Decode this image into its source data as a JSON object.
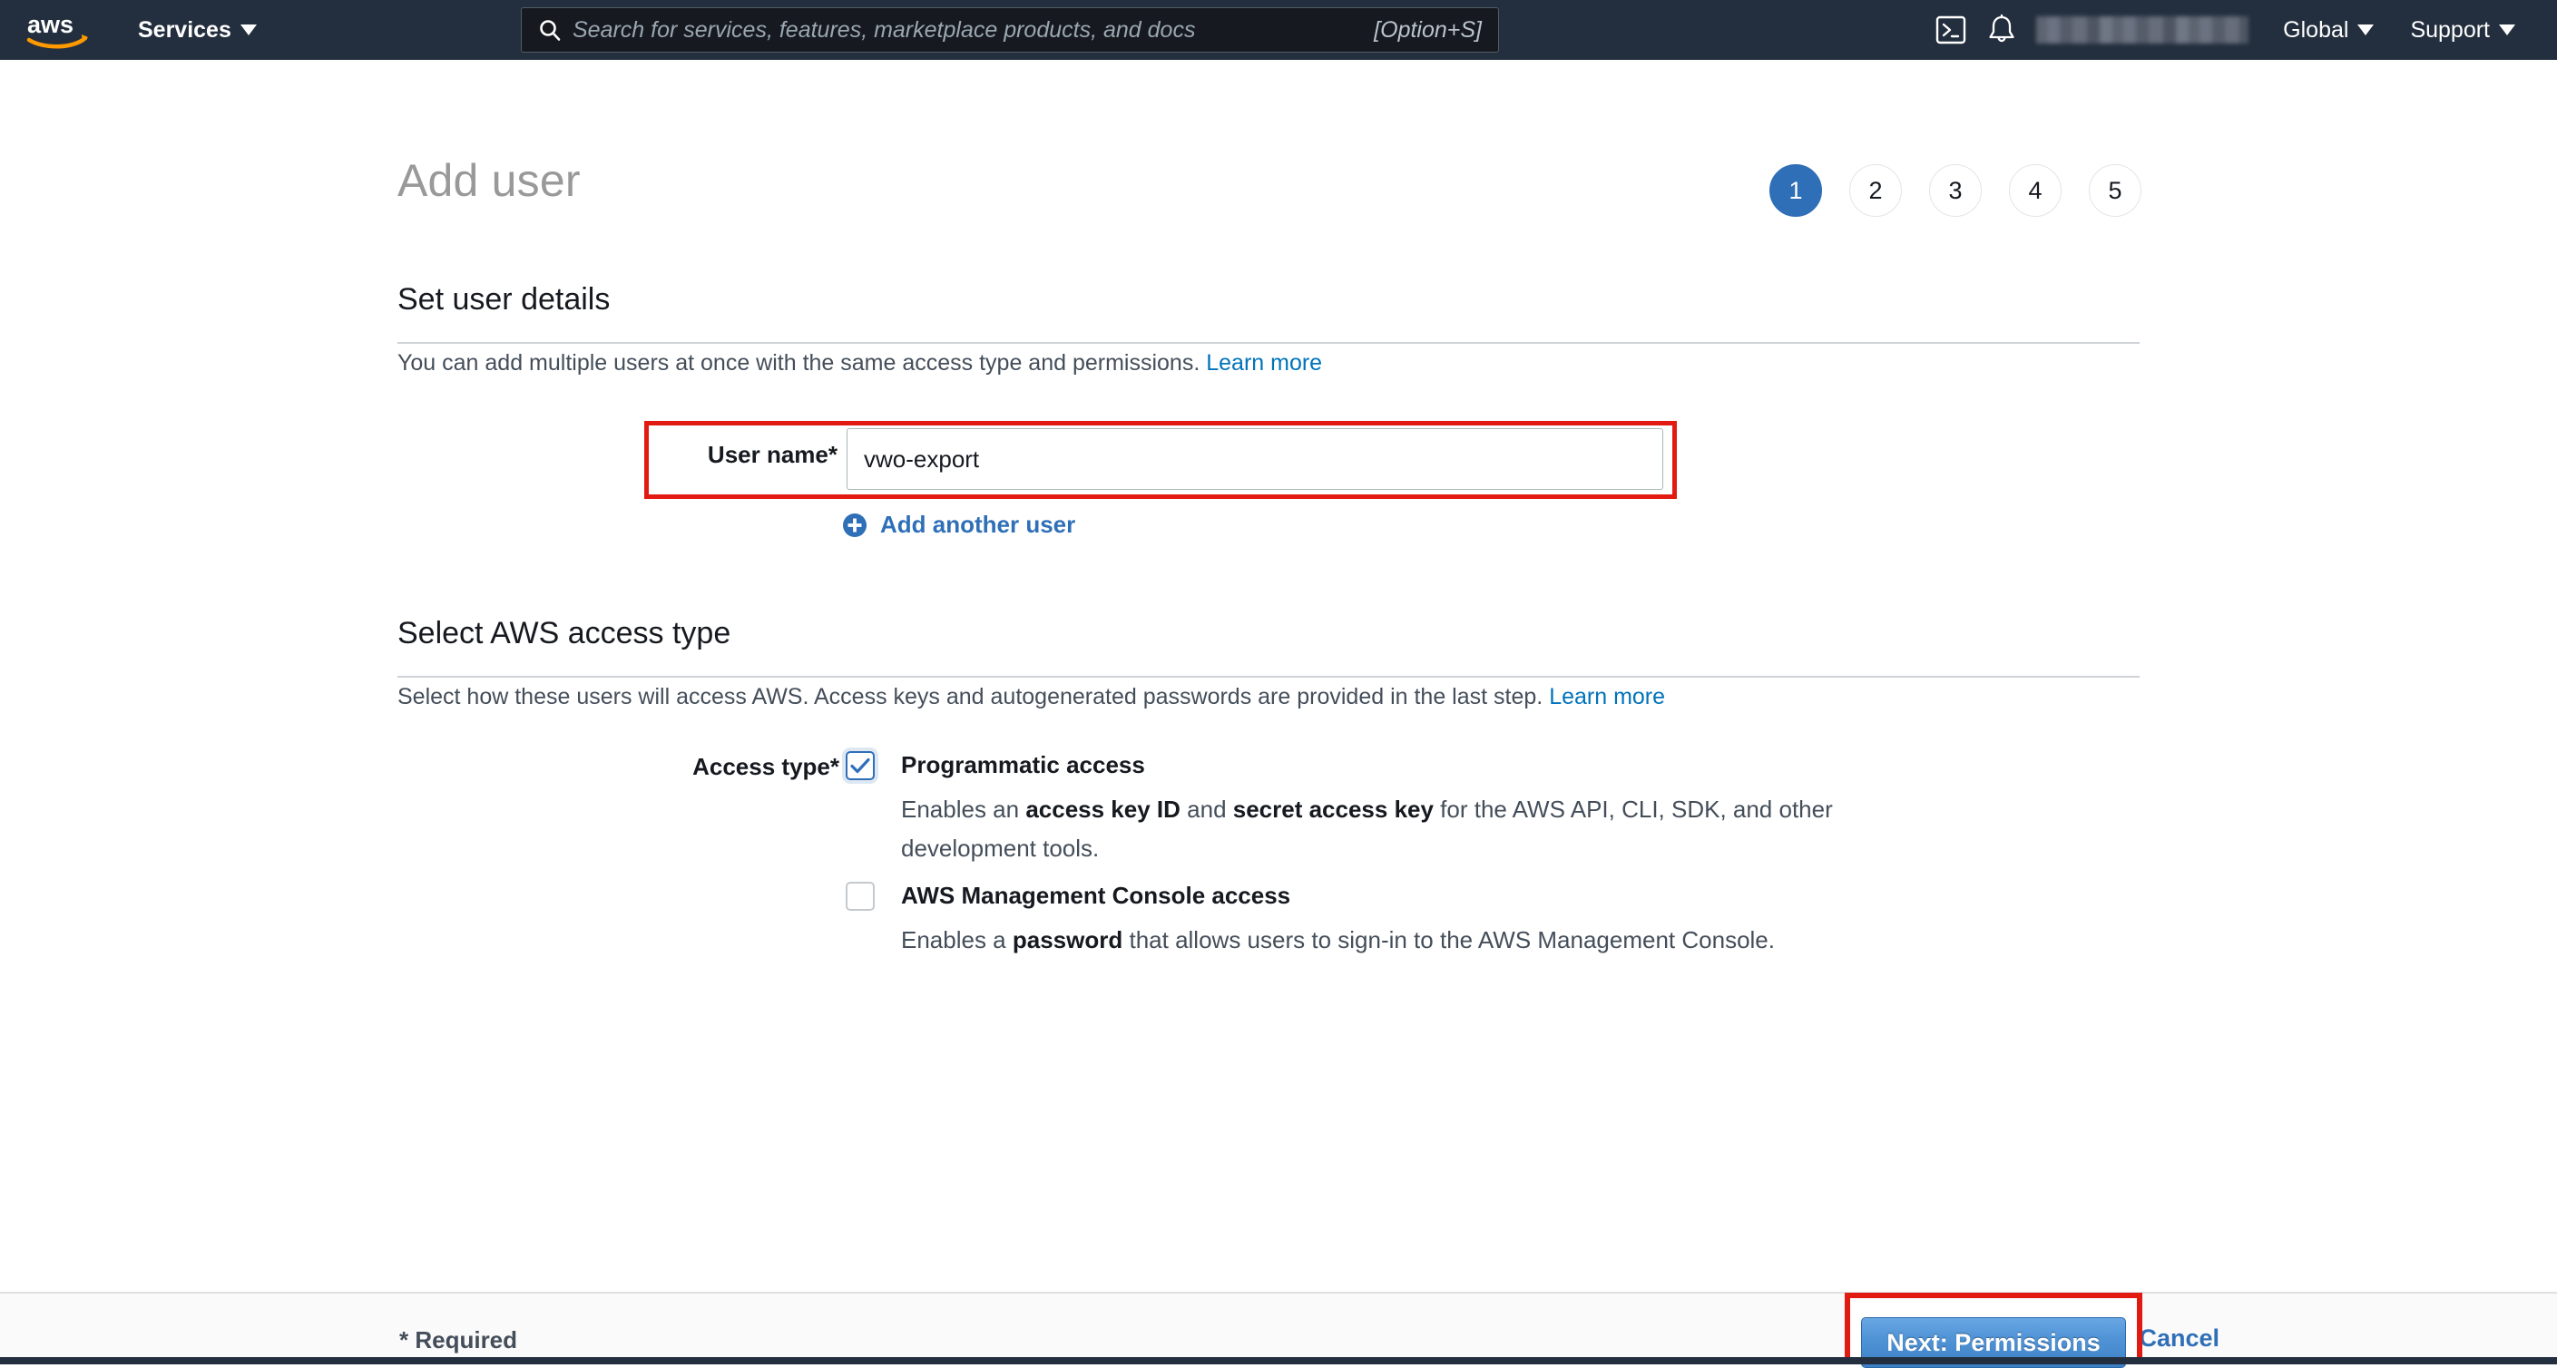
{
  "topnav": {
    "logo_name": "aws-logo",
    "services_label": "Services",
    "search": {
      "placeholder": "Search for services, features, marketplace products, and docs",
      "value": "",
      "shortcut": "[Option+S]"
    },
    "cloudshell_icon": "cloudshell-icon",
    "bell_icon": "notifications-bell-icon",
    "account_label": "",
    "region_label": "Global",
    "support_label": "Support",
    "background_color": "#232f3e"
  },
  "page": {
    "title": "Add user",
    "steps": [
      {
        "number": "1",
        "state": "active"
      },
      {
        "number": "2",
        "state": "inactive"
      },
      {
        "number": "3",
        "state": "inactive"
      },
      {
        "number": "4",
        "state": "inactive"
      },
      {
        "number": "5",
        "state": "inactive"
      }
    ],
    "active_step_color": "#2f6fb7"
  },
  "user_details": {
    "heading": "Set user details",
    "description": "You can add multiple users at once with the same access type and permissions.",
    "learn_more": "Learn more",
    "username_label": "User name*",
    "username_value": "vwo-export",
    "username_placeholder": "",
    "add_another_user": "Add another user",
    "highlight_color": "#e11b12"
  },
  "access_type": {
    "heading": "Select AWS access type",
    "description": "Select how these users will access AWS. Access keys and autogenerated passwords are provided in the last step.",
    "learn_more": "Learn more",
    "field_label": "Access type*",
    "options": [
      {
        "title": "Programmatic access",
        "checked": true,
        "description_parts": [
          {
            "text": "Enables an ",
            "bold": false
          },
          {
            "text": "access key ID",
            "bold": true
          },
          {
            "text": " and ",
            "bold": false
          },
          {
            "text": "secret access key",
            "bold": true
          },
          {
            "text": " for the AWS API, CLI, SDK, and other development tools.",
            "bold": false
          }
        ]
      },
      {
        "title": "AWS Management Console access",
        "checked": false,
        "description_parts": [
          {
            "text": "Enables a ",
            "bold": false
          },
          {
            "text": "password",
            "bold": true
          },
          {
            "text": " that allows users to sign-in to the AWS Management Console.",
            "bold": false
          }
        ]
      }
    ]
  },
  "footer": {
    "required_note": "* Required",
    "cancel_label": "Cancel",
    "next_label": "Next: Permissions",
    "next_highlight_color": "#e11b12",
    "next_button_color": "#3d80c6"
  }
}
